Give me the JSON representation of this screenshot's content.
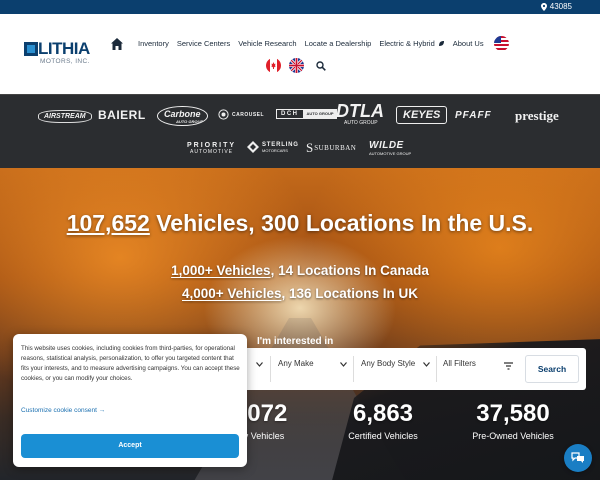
{
  "topbar": {
    "zip": "43085"
  },
  "logo": {
    "word": "LITHIA",
    "sub": "MOTORS, INC."
  },
  "nav": {
    "items": [
      "Inventory",
      "Service Centers",
      "Vehicle Research",
      "Locate a Dealership",
      "Electric & Hybrid",
      "About Us"
    ]
  },
  "brands": {
    "row1": [
      "AIRSTREAM",
      "BAIERL",
      "Carbone",
      "CAROUSEL",
      "DCH",
      "DTLA",
      "KEYES",
      "PFAFF",
      "prestige"
    ],
    "dtla_sub": "AUTO GROUP",
    "carbone_sub": "AUTO GROUP",
    "dch_sub": "AUTO GROUP",
    "row2": [
      "PRIORITY",
      "STERLING",
      "SUBURBAN",
      "WILDE"
    ],
    "priority_sub": "AUTOMOTIVE",
    "sterling_sub": "MOTORCARS",
    "wilde_sub": "AUTOMOTIVE GROUP"
  },
  "hero": {
    "us_count": "107,652",
    "us_rest": " Vehicles, 300 Locations In the U.S.",
    "ca_count": "1,000+ Vehicles",
    "ca_rest": ", 14 Locations In Canada",
    "uk_count": "4,000+ Vehicles",
    "uk_rest": ", 136 Locations In UK",
    "interest_label": "I'm interested in",
    "make": "Any Make",
    "body": "Any Body Style",
    "all_filters": "All Filters",
    "search": "Search",
    "stats": [
      {
        "num": ",072",
        "lbl": "v Vehicles"
      },
      {
        "num": "6,863",
        "lbl": "Certified Vehicles"
      },
      {
        "num": "37,580",
        "lbl": "Pre-Owned Vehicles"
      }
    ]
  },
  "cookie": {
    "text": "This website uses cookies, including cookies from third-parties, for operational reasons, statistical analysis, personalization, to offer you targeted content that fits your interests, and to measure advertising campaigns. You can accept these cookies, or you can modify your choices.",
    "customize": "Customize cookie consent →",
    "accept": "Accept"
  }
}
